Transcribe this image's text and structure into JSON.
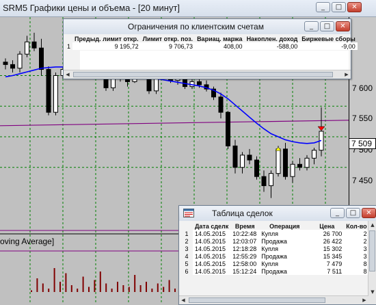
{
  "window": {
    "title": "SRM5 Графики цены и объема - [20 минут]",
    "minimize": "_",
    "maximize": "□",
    "close": "✕"
  },
  "axis": {
    "ticks": [
      "7 600",
      "7 550",
      "7 500",
      "7 450"
    ],
    "current_price": "7 509"
  },
  "indicator_label": "oving Average]",
  "limits_window": {
    "title": "Ограничения по клиентским счетам",
    "columns": [
      "",
      "Предыд. лимит откр.",
      "Лимит откр. поз.",
      "Вариац. маржа",
      "Накоплен. доход",
      "Биржевые сборы"
    ],
    "rows": [
      [
        "1",
        "9 195,72",
        "9 706,73",
        "408,00",
        "-588,00",
        "-9,00"
      ]
    ]
  },
  "deals_window": {
    "title": "Таблица сделок",
    "columns": [
      "",
      "Дата сделк",
      "Время",
      "Операция",
      "Цена",
      "Кол-во"
    ],
    "rows": [
      [
        "1",
        "14.05.2015",
        "10:22:48",
        "Купля",
        "26 700",
        "2"
      ],
      [
        "2",
        "14.05.2015",
        "12:03:07",
        "Продажа",
        "26 422",
        "2"
      ],
      [
        "3",
        "14.05.2015",
        "12:18:28",
        "Купля",
        "15 302",
        "3"
      ],
      [
        "4",
        "14.05.2015",
        "12:55:29",
        "Продажа",
        "15 345",
        "3"
      ],
      [
        "5",
        "14.05.2015",
        "12:58:00",
        "Купля",
        "7 479",
        "8"
      ],
      [
        "6",
        "14.05.2015",
        "15:12:24",
        "Продажа",
        "7 511",
        "8"
      ]
    ]
  },
  "colors": {
    "chart_bg": "#c0c0c0",
    "grid": "#008000",
    "moving_average": "#0000ff",
    "level_line": "#800080",
    "volume_bars": "#800000",
    "sell_marker": "#ff0000",
    "buy_marker": "#ffff00"
  },
  "chart_data": {
    "type": "candlestick",
    "yticks": [
      7450,
      7500,
      7550,
      7600
    ],
    "current_price": 7509,
    "level": 7527,
    "candles": [
      [
        7622,
        7628,
        7610,
        7618
      ],
      [
        7618,
        7625,
        7605,
        7612
      ],
      [
        7612,
        7640,
        7605,
        7635
      ],
      [
        7635,
        7665,
        7630,
        7655
      ],
      [
        7655,
        7670,
        7640,
        7645
      ],
      [
        7645,
        7660,
        7600,
        7610
      ],
      [
        7610,
        7615,
        7535,
        7540
      ],
      [
        7540,
        7605,
        7535,
        7600
      ],
      [
        7600,
        7615,
        7595,
        7610
      ],
      [
        7610,
        7615,
        7600,
        7605
      ],
      [
        7605,
        7612,
        7598,
        7608
      ],
      [
        7608,
        7640,
        7605,
        7635
      ],
      [
        7635,
        7680,
        7630,
        7660
      ],
      [
        7660,
        7665,
        7600,
        7605
      ],
      [
        7605,
        7610,
        7575,
        7580
      ],
      [
        7580,
        7605,
        7575,
        7600
      ],
      [
        7600,
        7605,
        7590,
        7598
      ],
      [
        7598,
        7603,
        7582,
        7590
      ],
      [
        7590,
        7640,
        7588,
        7635
      ],
      [
        7635,
        7650,
        7620,
        7625
      ],
      [
        7625,
        7630,
        7570,
        7575
      ],
      [
        7575,
        7610,
        7570,
        7605
      ],
      [
        7605,
        7612,
        7595,
        7600
      ],
      [
        7600,
        7605,
        7588,
        7592
      ],
      [
        7592,
        7600,
        7585,
        7595
      ],
      [
        7595,
        7600,
        7578,
        7582
      ],
      [
        7582,
        7595,
        7578,
        7590
      ],
      [
        7590,
        7598,
        7580,
        7585
      ],
      [
        7585,
        7592,
        7574,
        7578
      ],
      [
        7578,
        7582,
        7560,
        7565
      ],
      [
        7565,
        7572,
        7530,
        7540
      ],
      [
        7540,
        7542,
        7480,
        7485
      ],
      [
        7485,
        7495,
        7440,
        7450
      ],
      [
        7450,
        7475,
        7440,
        7470
      ],
      [
        7470,
        7480,
        7455,
        7462
      ],
      [
        7462,
        7468,
        7430,
        7435
      ],
      [
        7435,
        7445,
        7410,
        7420
      ],
      [
        7420,
        7445,
        7400,
        7440
      ],
      [
        7440,
        7485,
        7435,
        7480
      ],
      [
        7480,
        7490,
        7430,
        7435
      ],
      [
        7435,
        7460,
        7425,
        7455
      ],
      [
        7455,
        7465,
        7445,
        7450
      ],
      [
        7450,
        7470,
        7445,
        7465
      ],
      [
        7465,
        7482,
        7455,
        7478
      ],
      [
        7478,
        7548,
        7468,
        7509
      ]
    ],
    "moving_average": [
      7598,
      7600,
      7603,
      7606,
      7609,
      7612,
      7613,
      7614,
      7614,
      7614,
      7613,
      7613,
      7612,
      7611,
      7609,
      7607,
      7605,
      7603,
      7601,
      7599,
      7597,
      7595,
      7593,
      7591,
      7589,
      7587,
      7585,
      7583,
      7580,
      7576,
      7570,
      7562,
      7552,
      7542,
      7532,
      7522,
      7513,
      7505,
      7500,
      7495,
      7492,
      7490,
      7489,
      7490,
      7494
    ],
    "volumes": [
      0.05,
      0.4,
      0.25,
      0.1,
      0.7,
      0.3,
      0.55,
      0.2,
      0.1,
      0.45,
      0.15,
      0.35,
      0.6,
      0.25,
      0.1,
      0.3,
      0.2,
      0.15,
      0.5,
      0.2,
      0.3,
      0.1,
      0.25,
      0.15,
      0.35,
      0.1
    ],
    "signals": [
      {
        "candle": 38,
        "side": "buy",
        "price": 7483
      },
      {
        "candle": 44,
        "side": "sell",
        "price": 7510
      }
    ]
  }
}
